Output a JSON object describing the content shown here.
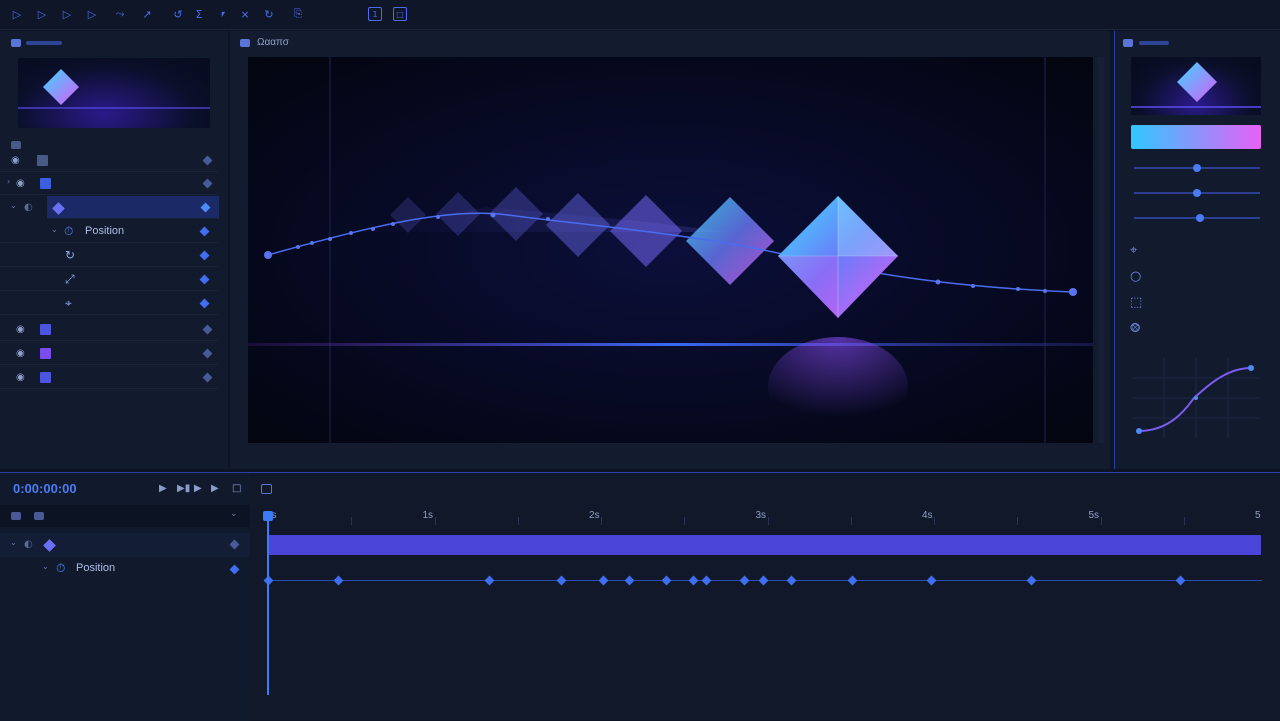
{
  "toolbar": {
    "icons": [
      "select-tool-icon",
      "play-tool-icon",
      "play-outline-tool-icon",
      "play-half-tool-icon",
      "path-tool-icon",
      "pen-tool-icon",
      "link-tool-icon",
      "text-tool-icon",
      "mask-tool-icon",
      "align-tool-icon",
      "rotate-tool-icon",
      "transform-tool-icon",
      "bounds-tool-icon",
      "snap-tool-icon"
    ]
  },
  "viewer": {
    "title": "Ωααπσ"
  },
  "layers": {
    "rows": [
      {
        "name": "folder-layer",
        "color": "#3b5fe0"
      },
      {
        "name": "layer-1",
        "color": "#3b5fe0"
      },
      {
        "name": "diamond-layer",
        "color": "#5b6cf5",
        "selected": true
      },
      {
        "name": "position-property",
        "label": "Position"
      },
      {
        "name": "rotation-property"
      },
      {
        "name": "scale-property"
      },
      {
        "name": "anchor-property"
      },
      {
        "name": "layer-2",
        "color": "#4b55e0"
      },
      {
        "name": "layer-3",
        "color": "#7b4cf0"
      },
      {
        "name": "layer-4",
        "color": "#4b55e0"
      }
    ],
    "position_label": "Position"
  },
  "timeline": {
    "timecode": "0:00:00:00",
    "ruler": [
      "0s",
      "1s",
      "2s",
      "3s",
      "4s",
      "5s",
      "5"
    ],
    "position_label": "Position",
    "position_keyframes_s": [
      0.0,
      0.42,
      1.33,
      1.76,
      2.01,
      2.17,
      2.39,
      2.55,
      2.63,
      2.86,
      2.97,
      3.14,
      3.51,
      3.98,
      4.58,
      5.48
    ]
  },
  "inspector": {
    "gradient_start": "#2ec8ff",
    "gradient_end": "#e860f5",
    "sliders": [
      0.5,
      0.5,
      0.52
    ],
    "icons": [
      "crosshair-icon",
      "rotate-icon",
      "scale-icon",
      "anchor-icon"
    ]
  },
  "colors": {
    "accent": "#3f6ef0",
    "selection": "#1b2a66",
    "timebar": "#4a44d8"
  }
}
